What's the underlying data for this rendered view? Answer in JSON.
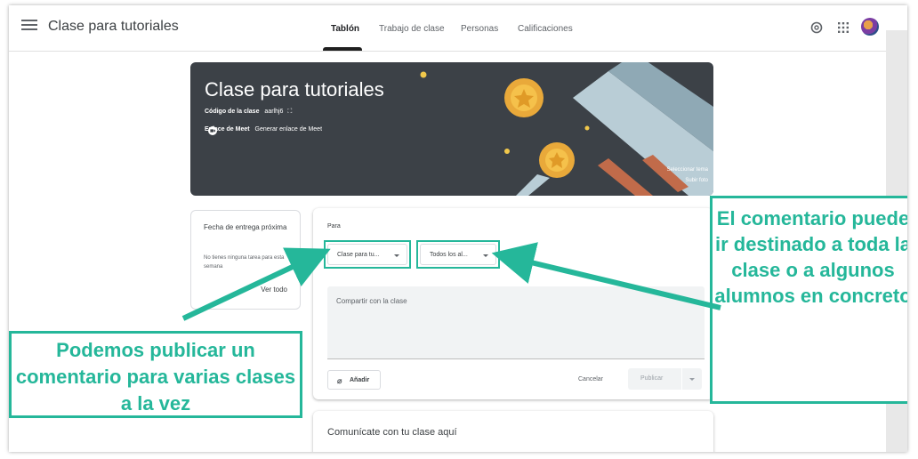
{
  "header": {
    "app_title": "Clase para tutoriales",
    "tabs": [
      {
        "label": "Tablón",
        "active": true
      },
      {
        "label": "Trabajo de clase",
        "active": false
      },
      {
        "label": "Personas",
        "active": false
      },
      {
        "label": "Calificaciones",
        "active": false
      }
    ]
  },
  "banner": {
    "title": "Clase para tutoriales",
    "class_code_label": "Código de la clase",
    "class_code_value": "aarlhj6",
    "meet_label": "Enlace de Meet",
    "meet_link": "Generar enlace de Meet",
    "select_theme": "Seleccionar tema",
    "upload_photo": "Subir foto",
    "bg_color": "#3c4147"
  },
  "upcoming": {
    "title": "Fecha de entrega próxima",
    "empty_text": "No tienes ninguna tarea para esta semana",
    "view_all": "Ver todo"
  },
  "post": {
    "to_label": "Para",
    "class_dropdown": "Clase para tu...",
    "students_dropdown": "Todos los al...",
    "share_placeholder": "Compartir con la clase",
    "add_label": "Añadir",
    "cancel_label": "Cancelar",
    "publish_label": "Publicar"
  },
  "communicate": {
    "text": "Comunícate con tu clase aquí"
  },
  "annotations": {
    "left_callout": "Podemos publicar un comentario para varias clases a la vez",
    "right_callout": "El comentario puede ir destinado a toda la clase o a algunos alumnos en concreto",
    "accent_color": "#25b79a"
  },
  "icons": {
    "menu": "menu-icon",
    "settings": "settings-icon",
    "apps": "apps-icon",
    "attach": "paperclip-icon",
    "meet": "meet-icon",
    "copy": "fullscreen-icon"
  }
}
